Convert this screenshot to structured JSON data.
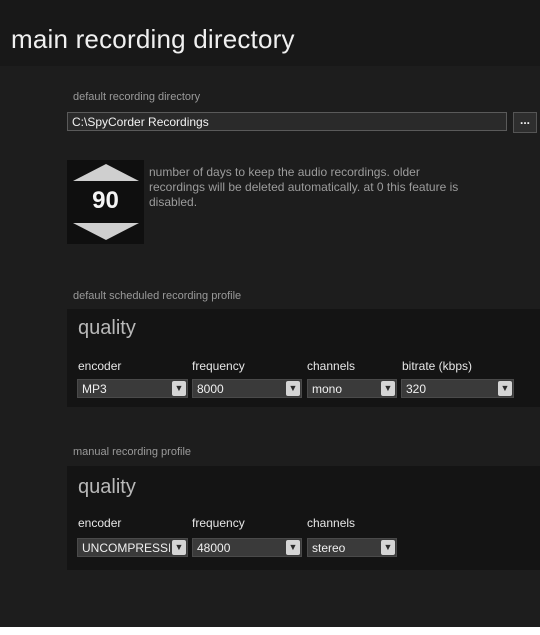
{
  "page": {
    "title": "main recording directory"
  },
  "recording_directory": {
    "label": "default recording directory",
    "value": "C:\\SpyCorder Recordings",
    "browse_label": "..."
  },
  "retention": {
    "days": "90",
    "description": "number of days to keep the audio recordings. older recordings will be deleted automatically. at 0 this feature is disabled."
  },
  "scheduled_profile": {
    "label": "default scheduled recording profile",
    "quality_title": "quality",
    "columns": {
      "encoder": "encoder",
      "frequency": "frequency",
      "channels": "channels",
      "bitrate": "bitrate (kbps)"
    },
    "values": {
      "encoder": "MP3",
      "frequency": "8000",
      "channels": "mono",
      "bitrate": "320"
    }
  },
  "manual_profile": {
    "label": "manual recording profile",
    "quality_title": "quality",
    "columns": {
      "encoder": "encoder",
      "frequency": "frequency",
      "channels": "channels"
    },
    "values": {
      "encoder": "UNCOMPRESSI",
      "frequency": "48000",
      "channels": "stereo"
    }
  },
  "icons": {
    "dropdown": "chevron-down-icon",
    "stepper_up": "triangle-up-icon",
    "stepper_down": "triangle-down-icon"
  },
  "colors": {
    "background": "#181818",
    "section_background": "#141414",
    "dropdown_background": "#3a3a3a",
    "text_primary": "#f0f0f0",
    "text_muted": "#9a9a9a"
  }
}
